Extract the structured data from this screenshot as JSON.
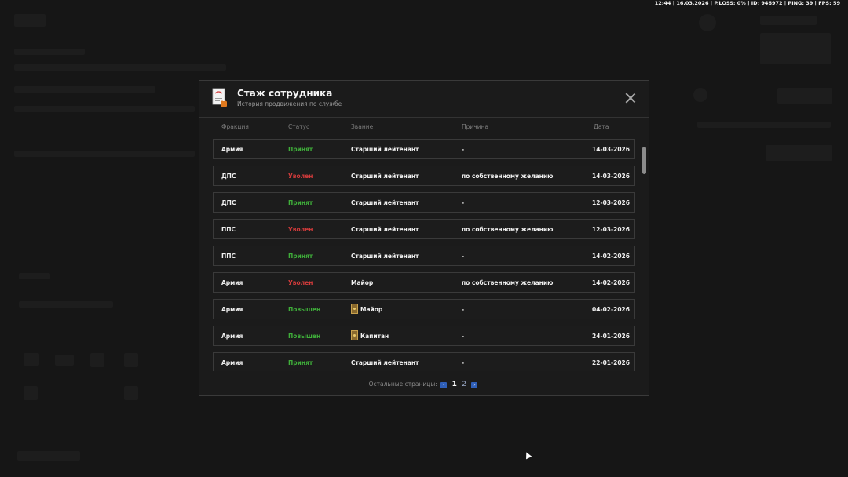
{
  "status_bar": {
    "text": "12:44 | 16.03.2026 | P.LOSS: 0% | ID: 946972 | PING: 39 | FPS: 59"
  },
  "modal": {
    "title": "Стаж сотрудника",
    "subtitle": "История продвижения по службе",
    "columns": {
      "faction": "Фракция",
      "status": "Статус",
      "rank": "Звание",
      "reason": "Причина",
      "date": "Дата"
    },
    "rows": [
      {
        "faction": "Армия",
        "status": "Принят",
        "status_type": "ok",
        "rank": "Старший лейтенант",
        "has_badge": false,
        "reason": "-",
        "date": "14-03-2026"
      },
      {
        "faction": "ДПС",
        "status": "Уволен",
        "status_type": "bad",
        "rank": "Старший лейтенант",
        "has_badge": false,
        "reason": "по собственному желанию",
        "date": "14-03-2026"
      },
      {
        "faction": "ДПС",
        "status": "Принят",
        "status_type": "ok",
        "rank": "Старший лейтенант",
        "has_badge": false,
        "reason": "-",
        "date": "12-03-2026"
      },
      {
        "faction": "ППС",
        "status": "Уволен",
        "status_type": "bad",
        "rank": "Старший лейтенант",
        "has_badge": false,
        "reason": "по собственному желанию",
        "date": "12-03-2026"
      },
      {
        "faction": "ППС",
        "status": "Принят",
        "status_type": "ok",
        "rank": "Старший лейтенант",
        "has_badge": false,
        "reason": "-",
        "date": "14-02-2026"
      },
      {
        "faction": "Армия",
        "status": "Уволен",
        "status_type": "bad",
        "rank": "Майор",
        "has_badge": false,
        "reason": "по собственному желанию",
        "date": "14-02-2026"
      },
      {
        "faction": "Армия",
        "status": "Повышен",
        "status_type": "ok",
        "rank": "Майор",
        "has_badge": true,
        "reason": "-",
        "date": "04-02-2026"
      },
      {
        "faction": "Армия",
        "status": "Повышен",
        "status_type": "ok",
        "rank": "Капитан",
        "has_badge": true,
        "reason": "-",
        "date": "24-01-2026"
      },
      {
        "faction": "Армия",
        "status": "Принят",
        "status_type": "ok",
        "rank": "Старший лейтенант",
        "has_badge": false,
        "reason": "-",
        "date": "22-01-2026"
      }
    ],
    "pagination": {
      "label": "Остальные страницы:",
      "prev": "‹",
      "next": "›",
      "pages": [
        "1",
        "2"
      ],
      "current": "1"
    }
  },
  "colors": {
    "accepted": "#3fae3a",
    "fired": "#d23b3b",
    "page_arrow": "#2f5fb8"
  }
}
